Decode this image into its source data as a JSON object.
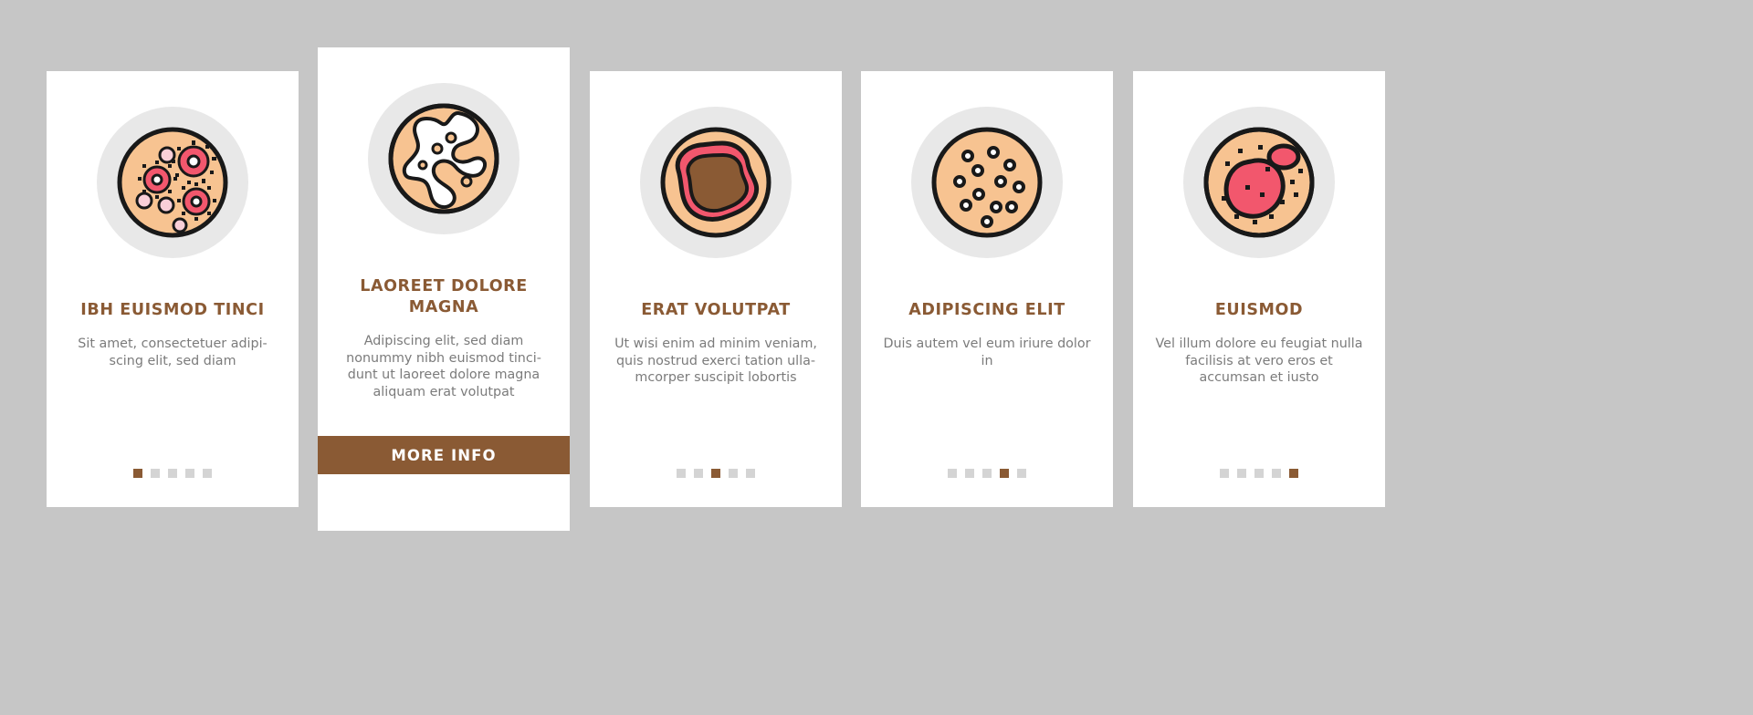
{
  "theme": {
    "background": "#c6c6c6",
    "card_background": "#ffffff",
    "accent": "#8a5a34",
    "title_color": "#8a5a34",
    "body_color": "#7b7b7b",
    "pip_inactive": "#d4d4d4",
    "illustration_disc": "#e8e8e8",
    "illustration_fill": "#f7c391",
    "illustration_outline": "#191919",
    "illustration_pink": "#f2576d",
    "illustration_brown": "#8a5a34",
    "illustration_white": "#ffffff"
  },
  "cards": [
    {
      "id": "card-1",
      "icon": "petri-dish-bacteria-colonies-icon",
      "title": "IBH EUISMOD TINCI",
      "body": "Sit amet, consectetuer adipi-scing elit, sed diam",
      "pips": {
        "count": 5,
        "active_index": 0
      },
      "featured": false
    },
    {
      "id": "card-2",
      "icon": "petri-dish-white-mold-icon",
      "title": "LAOREET DOLORE MAGNA",
      "body": "Adipiscing elit, sed diam nonummy nibh euismod tinci-dunt ut laoreet dolore magna aliquam erat volutpat",
      "button_label": "MORE INFO",
      "featured": true
    },
    {
      "id": "card-3",
      "icon": "petri-dish-large-colony-icon",
      "title": "ERAT VOLUTPAT",
      "body": "Ut wisi enim ad minim veniam, quis nostrud exerci tation ulla-mcorper suscipit lobortis",
      "pips": {
        "count": 5,
        "active_index": 2
      },
      "featured": false
    },
    {
      "id": "card-4",
      "icon": "petri-dish-dots-colonies-icon",
      "title": "ADIPISCING ELIT",
      "body": "Duis autem vel eum iriure dolor in",
      "pips": {
        "count": 5,
        "active_index": 3
      },
      "featured": false
    },
    {
      "id": "card-5",
      "icon": "petri-dish-pink-growth-icon",
      "title": "EUISMOD",
      "body": "Vel illum dolore eu feugiat nulla facilisis at vero eros et accumsan et iusto",
      "pips": {
        "count": 5,
        "active_index": 4
      },
      "featured": false
    }
  ]
}
